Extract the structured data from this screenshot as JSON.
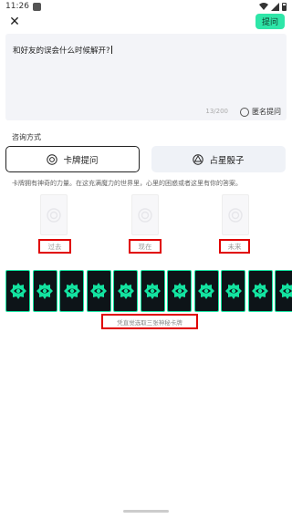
{
  "status_bar": {
    "time": "11:26"
  },
  "header": {
    "ask_label": "提问"
  },
  "question": {
    "text": "和好友的误会什么时候解开?",
    "counter": "13/200",
    "anonymous_label": "匿名提问"
  },
  "consult": {
    "section_label": "咨询方式",
    "tabs": [
      {
        "label": "卡牌提问",
        "icon": "tarot-icon",
        "active": true
      },
      {
        "label": "占星骰子",
        "icon": "dice-icon",
        "active": false
      }
    ],
    "intro": "卡牌拥有神奇的力量。在这充满魔力的世界里，心里的困惑或者这里有你的答案。"
  },
  "spread": {
    "slots": [
      {
        "label": "过去"
      },
      {
        "label": "现在"
      },
      {
        "label": "未来"
      }
    ]
  },
  "deck": {
    "card_count": 12,
    "hint": "凭直觉选取三张神秘卡牌",
    "accent_color": "#13e3a0"
  },
  "colors": {
    "primary": "#2ee6a8",
    "highlight_box": "#e00000"
  }
}
